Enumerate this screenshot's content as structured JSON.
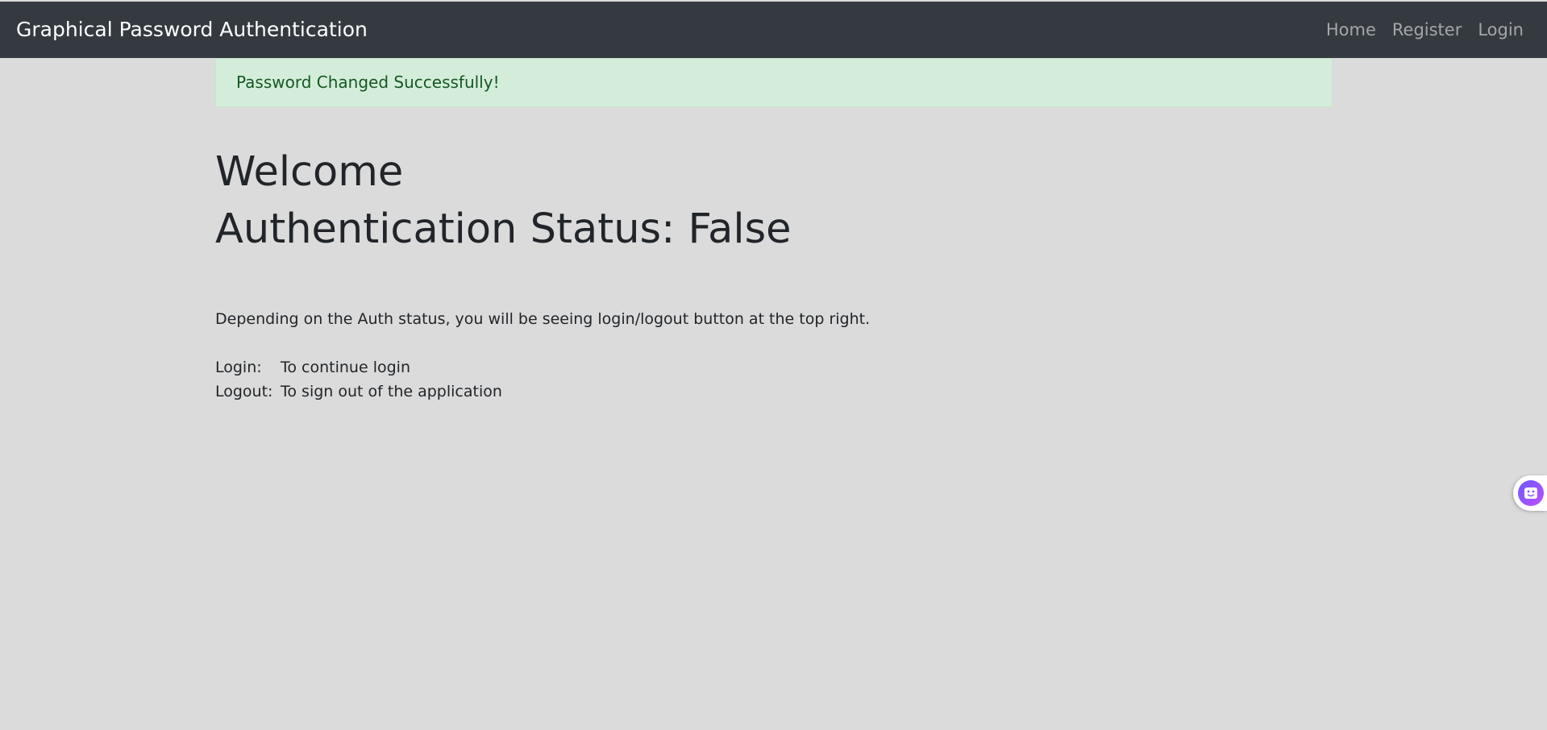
{
  "navbar": {
    "brand": "Graphical Password Authentication",
    "links": [
      {
        "label": "Home"
      },
      {
        "label": "Register"
      },
      {
        "label": "Login"
      }
    ]
  },
  "alert": {
    "message": "Password Changed Successfully!"
  },
  "main": {
    "welcome": "Welcome",
    "status_label": "Authentication Status: ",
    "status_value": "False",
    "description": "Depending on the Auth status, you will be seeing login/logout button at the top right.",
    "items": [
      {
        "key": "Login:",
        "text": "To continue login"
      },
      {
        "key": "Logout:",
        "text": "To sign out of the application"
      }
    ]
  },
  "widgets": {
    "assistant_icon": "smiley-assistant-icon",
    "colors": {
      "navbar_bg": "#343a40",
      "alert_bg": "#d4edda",
      "alert_text": "#155724",
      "page_bg": "#dbdbdb"
    }
  }
}
